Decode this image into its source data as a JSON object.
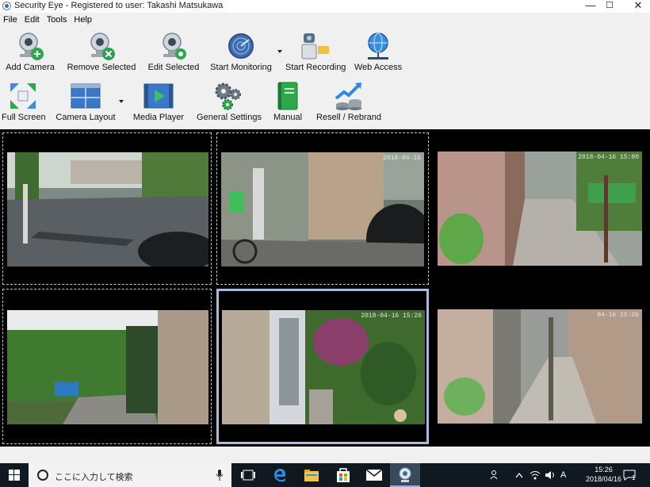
{
  "window": {
    "title": "Security Eye - Registered to user: Takashi Matsukawa",
    "minimize": "—",
    "maximize": "☐",
    "close": "✕"
  },
  "menu": [
    "File",
    "Edit",
    "Tools",
    "Help"
  ],
  "toolbar_row1": [
    {
      "label": "Add Camera",
      "icon": "add-camera-icon"
    },
    {
      "label": "Remove Selected",
      "icon": "remove-camera-icon"
    },
    {
      "label": "Edit Selected",
      "icon": "edit-camera-icon"
    },
    {
      "label": "Start Monitoring",
      "icon": "radar-icon"
    },
    {
      "label": "Start Recording",
      "icon": "recording-icon"
    },
    {
      "label": "Web Access",
      "icon": "globe-icon"
    }
  ],
  "toolbar_row2": [
    {
      "label": "Full Screen",
      "icon": "fullscreen-icon"
    },
    {
      "label": "Camera Layout",
      "icon": "layout-icon"
    },
    {
      "label": "Media Player",
      "icon": "media-player-icon"
    },
    {
      "label": "General Settings",
      "icon": "gears-icon"
    },
    {
      "label": "Manual",
      "icon": "book-icon"
    },
    {
      "label": "Resell / Rebrand",
      "icon": "coins-icon"
    }
  ],
  "cameras": [
    {
      "timestamp": ""
    },
    {
      "timestamp": "2018-04-16"
    },
    {
      "timestamp": "2018-04-16 15:00"
    },
    {
      "timestamp": ""
    },
    {
      "timestamp": "2018-04-16 15:26"
    },
    {
      "timestamp": "04-16 15:26"
    }
  ],
  "taskbar": {
    "search_placeholder": "ここに入力して検索",
    "ime": "A",
    "time": "15:26",
    "date": "2018/04/16",
    "notification_count": "1"
  },
  "colors": {
    "accent_select": "#a9bbe0",
    "taskbar": "#101820"
  }
}
